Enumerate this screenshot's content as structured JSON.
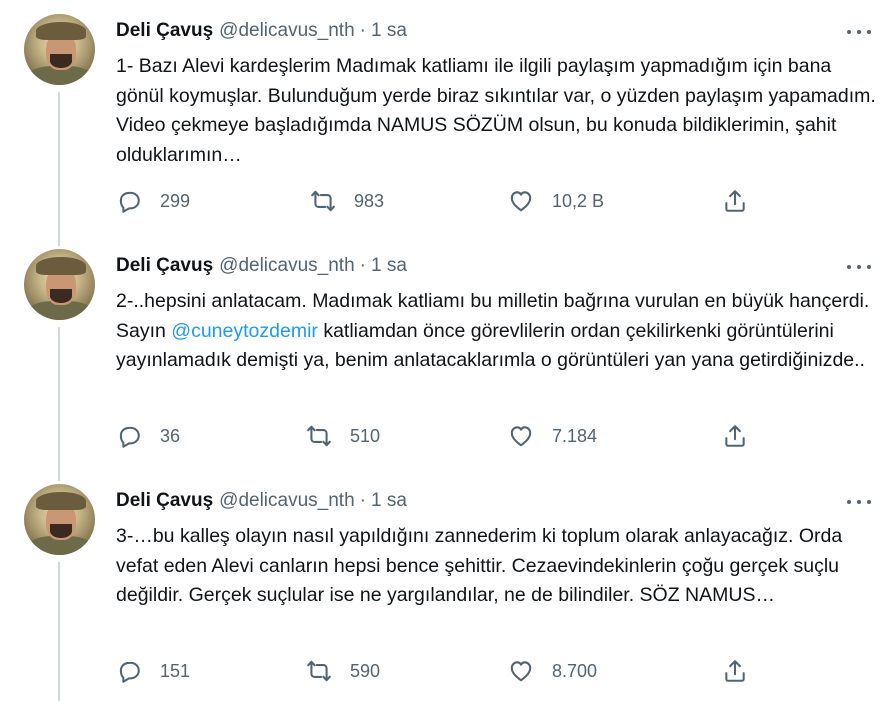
{
  "tweets": [
    {
      "author_name": "Deli Çavuş",
      "handle": "@delicavus_nth",
      "separator": "·",
      "time": "1 sa",
      "text_parts": [
        "1- Bazı Alevi kardeşlerim Madımak katliamı ile ilgili paylaşım yapmadığım için bana gönül koymuşlar. Bulunduğum yerde biraz sıkıntılar var, o yüzden paylaşım yapamadım. Video çekmeye başladığımda NAMUS SÖZÜM olsun, bu konuda bildiklerimin, şahit olduklarımın…"
      ],
      "replies": "299",
      "retweets": "983",
      "likes": "10,2 B"
    },
    {
      "author_name": "Deli Çavuş",
      "handle": "@delicavus_nth",
      "separator": "·",
      "time": "1 sa",
      "text_before": "2-..hepsini anlatacam. Madımak katliamı bu milletin bağrına vurulan en büyük hançerdi. Sayın ",
      "mention": "@cuneytozdemir",
      "text_after": " katliamdan önce görevlilerin ordan çekilirkenki görüntülerini yayınlamadık demişti ya, benim anlatacaklarımla o görüntüleri yan yana getirdiğinizde..",
      "replies": "36",
      "retweets": "510",
      "likes": "7.184"
    },
    {
      "author_name": "Deli Çavuş",
      "handle": "@delicavus_nth",
      "separator": "·",
      "time": "1 sa",
      "text_parts": [
        "3-…bu kalleş olayın nasıl yapıldığını zannederim ki toplum olarak anlayacağız. Orda vefat eden Alevi canların hepsi bence şehittir. Cezaevindekinlerin çoğu gerçek suçlu değildir. Gerçek suçlular ise ne yargılandılar, ne de bilindiler. SÖZ NAMUS…"
      ],
      "replies": "151",
      "retweets": "590",
      "likes": "8.700"
    }
  ],
  "icons": {
    "reply": "reply-icon",
    "retweet": "retweet-icon",
    "like": "heart-icon",
    "share": "share-icon",
    "more": "more-icon"
  },
  "colors": {
    "text": "#0f1419",
    "secondary": "#536471",
    "link": "#1d9bf0",
    "thread_line": "#cfd9de"
  }
}
